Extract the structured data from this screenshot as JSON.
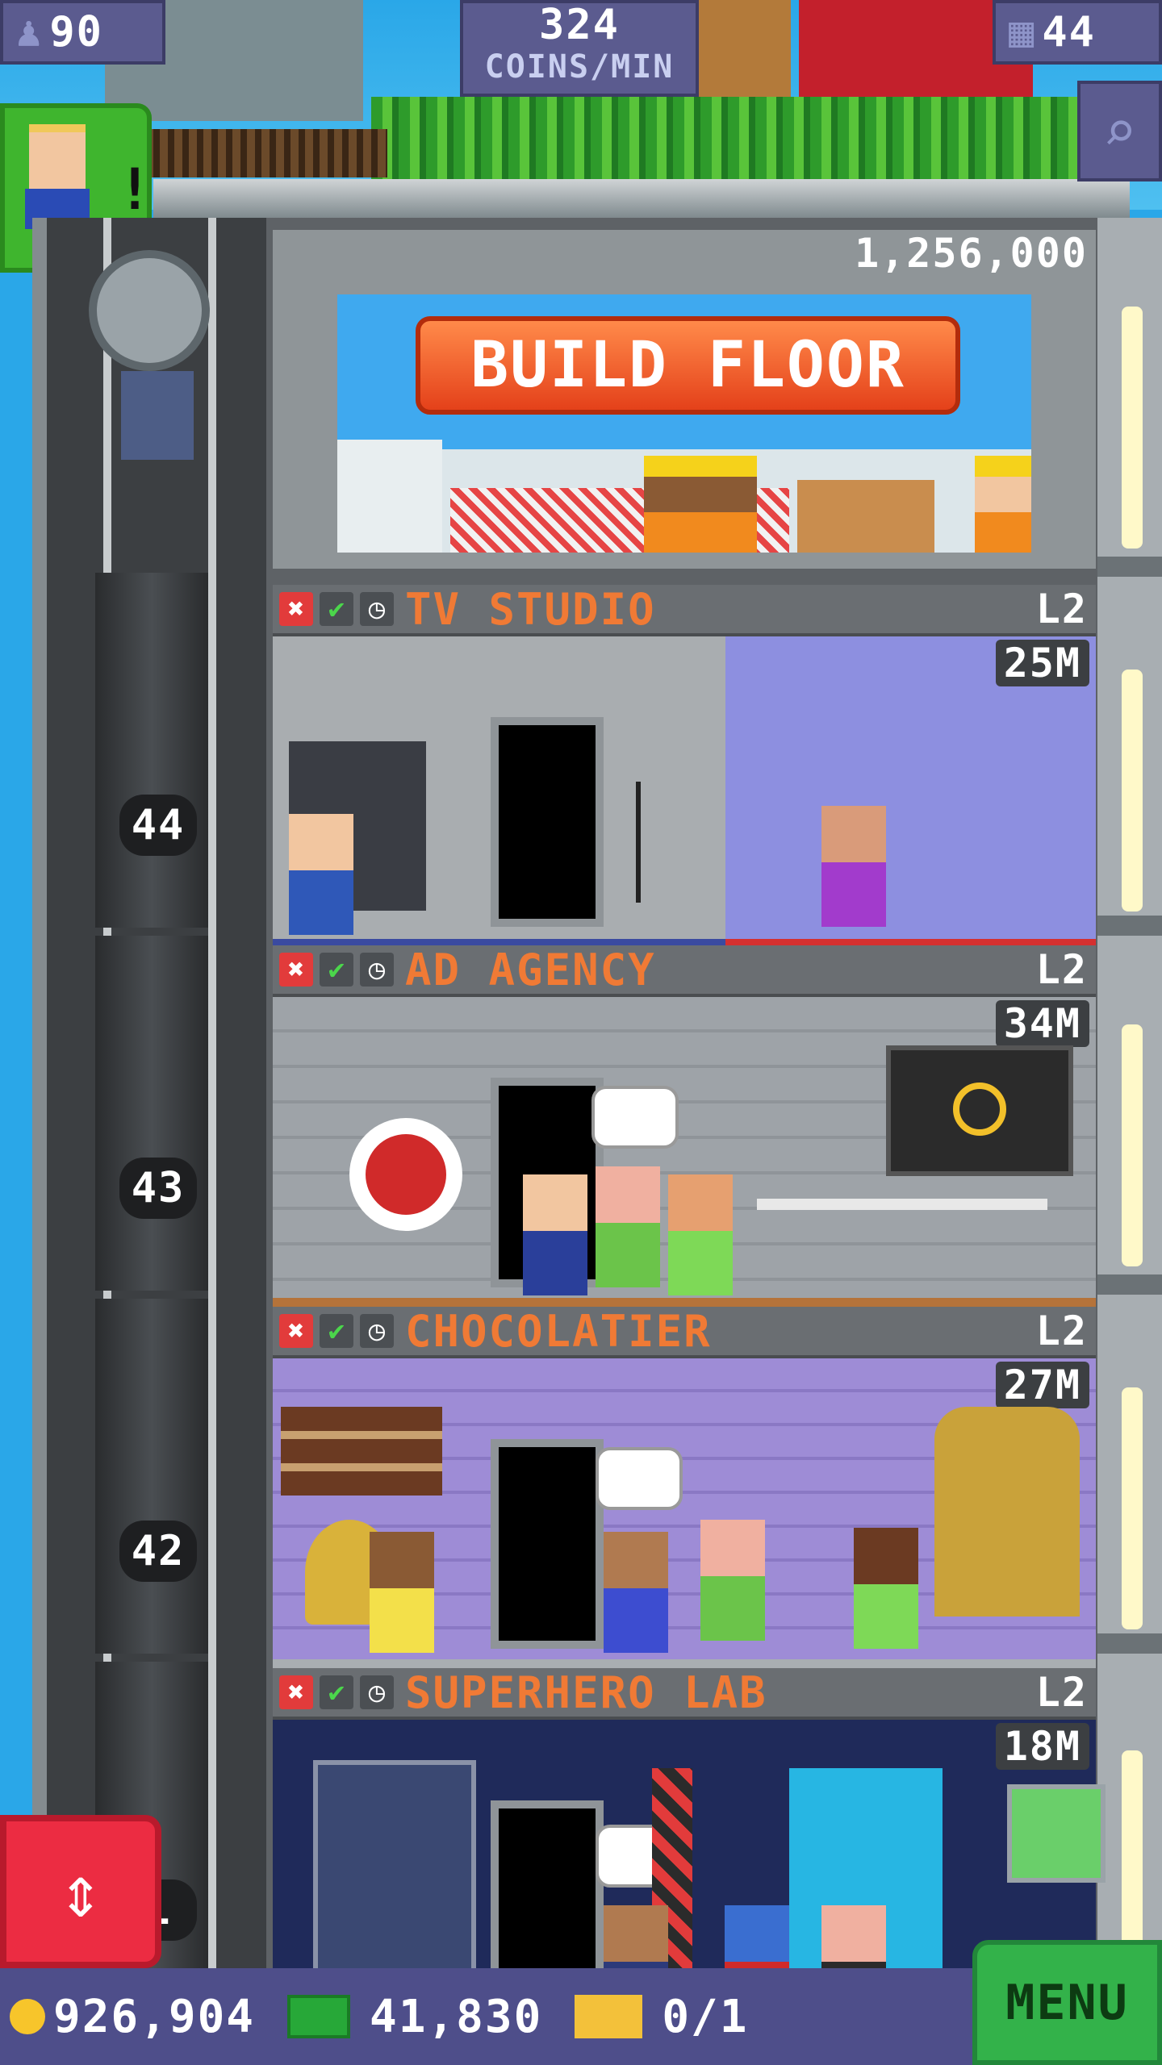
{
  "hud": {
    "population": "90",
    "coin_rate": "324",
    "coin_rate_unit": "COINS/MIN",
    "floor_count": "44"
  },
  "build_floor": {
    "cost": "1,256,000",
    "button_label": "BUILD FLOOR"
  },
  "floors": [
    {
      "name": "TV STUDIO",
      "level": "L2",
      "earnings": "25M"
    },
    {
      "name": "AD AGENCY",
      "level": "L2",
      "earnings": "34M"
    },
    {
      "name": "CHOCOLATIER",
      "level": "L2",
      "earnings": "27M"
    },
    {
      "name": "SUPERHERO LAB",
      "level": "L2",
      "earnings": "18M"
    }
  ],
  "elevator_floor_numbers": [
    "44",
    "43",
    "42",
    "1"
  ],
  "bottom_bar": {
    "coins": "926,904",
    "tower_bux": "41,830",
    "tickets": "0/1",
    "menu_label": "MENU"
  },
  "colors": {
    "sky": "#2aa7e8",
    "hud_bg": "#5b5b8f",
    "floor_name": "#f07a35",
    "build_button": "#e4411a",
    "menu_button": "#33b24a",
    "elevator_button": "#ec2c42"
  },
  "icons": {
    "population": "person-icon",
    "floors": "building-icon",
    "search": "magnifier-icon",
    "floor_actions": [
      "close-icon",
      "check-icon",
      "clock-icon"
    ],
    "coin": "coin-icon",
    "bux": "cash-icon",
    "ticket": "ticket-icon"
  }
}
